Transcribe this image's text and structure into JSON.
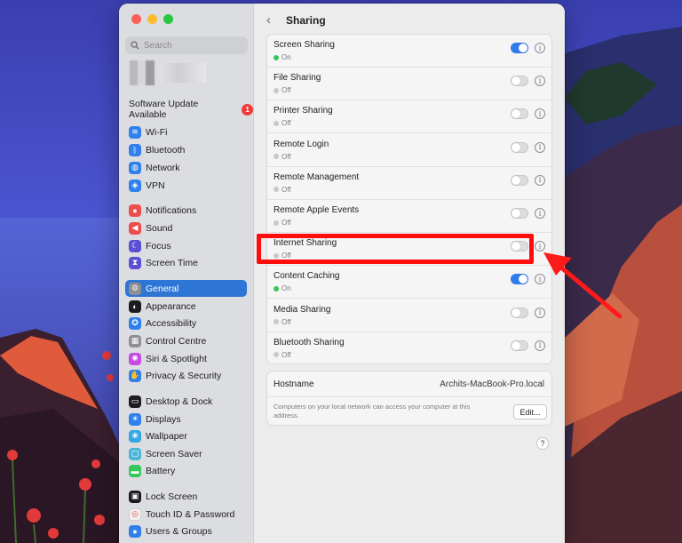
{
  "sidebar": {
    "search_placeholder": "Search",
    "update_label": "Software Update Available",
    "update_badge": "1",
    "items": [
      {
        "label": "Wi-Fi",
        "icon": "wifi-icon",
        "color": "#2f80ed"
      },
      {
        "label": "Bluetooth",
        "icon": "bluetooth-icon",
        "color": "#2f80ed"
      },
      {
        "label": "Network",
        "icon": "globe-icon",
        "color": "#2f80ed"
      },
      {
        "label": "VPN",
        "icon": "vpn-icon",
        "color": "#2f80ed"
      },
      {
        "label": "Notifications",
        "icon": "bell-icon",
        "color": "#ef4d4d"
      },
      {
        "label": "Sound",
        "icon": "speaker-icon",
        "color": "#ef4d4d"
      },
      {
        "label": "Focus",
        "icon": "moon-icon",
        "color": "#5b4fd6"
      },
      {
        "label": "Screen Time",
        "icon": "hourglass-icon",
        "color": "#5b4fd6"
      },
      {
        "label": "General",
        "icon": "gear-icon",
        "color": "#8e8e93"
      },
      {
        "label": "Appearance",
        "icon": "appearance-icon",
        "color": "#1c1c1e"
      },
      {
        "label": "Accessibility",
        "icon": "accessibility-icon",
        "color": "#2f80ed"
      },
      {
        "label": "Control Centre",
        "icon": "control-centre-icon",
        "color": "#8e8e93"
      },
      {
        "label": "Siri & Spotlight",
        "icon": "siri-icon",
        "color": "#c64be3"
      },
      {
        "label": "Privacy & Security",
        "icon": "hand-icon",
        "color": "#2f80ed"
      },
      {
        "label": "Desktop & Dock",
        "icon": "dock-icon",
        "color": "#1c1c1e"
      },
      {
        "label": "Displays",
        "icon": "sun-icon",
        "color": "#2f80ed"
      },
      {
        "label": "Wallpaper",
        "icon": "wallpaper-icon",
        "color": "#35a7e0"
      },
      {
        "label": "Screen Saver",
        "icon": "screen-saver-icon",
        "color": "#4ab5d9"
      },
      {
        "label": "Battery",
        "icon": "battery-icon",
        "color": "#34c759"
      },
      {
        "label": "Lock Screen",
        "icon": "lock-icon",
        "color": "#1c1c1e"
      },
      {
        "label": "Touch ID & Password",
        "icon": "fingerprint-icon",
        "color": "#f2f2f2"
      },
      {
        "label": "Users & Groups",
        "icon": "users-icon",
        "color": "#2f80ed"
      }
    ],
    "selected": "General"
  },
  "header": {
    "back": "‹",
    "title": "Sharing"
  },
  "services": [
    {
      "name": "Screen Sharing",
      "status": "On",
      "on": true
    },
    {
      "name": "File Sharing",
      "status": "Off",
      "on": false
    },
    {
      "name": "Printer Sharing",
      "status": "Off",
      "on": false
    },
    {
      "name": "Remote Login",
      "status": "Off",
      "on": false
    },
    {
      "name": "Remote Management",
      "status": "Off",
      "on": false
    },
    {
      "name": "Remote Apple Events",
      "status": "Off",
      "on": false
    },
    {
      "name": "Internet Sharing",
      "status": "Off",
      "on": false
    },
    {
      "name": "Content Caching",
      "status": "On",
      "on": true
    },
    {
      "name": "Media Sharing",
      "status": "Off",
      "on": false
    },
    {
      "name": "Bluetooth Sharing",
      "status": "Off",
      "on": false
    }
  ],
  "info_glyph": "i",
  "hostname": {
    "label": "Hostname",
    "value": "Archits-MacBook-Pro.local",
    "note": "Computers on your local network can access your computer at this address.",
    "edit_label": "Edit..."
  },
  "help_label": "?",
  "colors": {
    "accent": "#2e76d6",
    "toggle_on": "#2f7bea",
    "status_on": "#34c759",
    "highlight": "#ff0d0d"
  }
}
